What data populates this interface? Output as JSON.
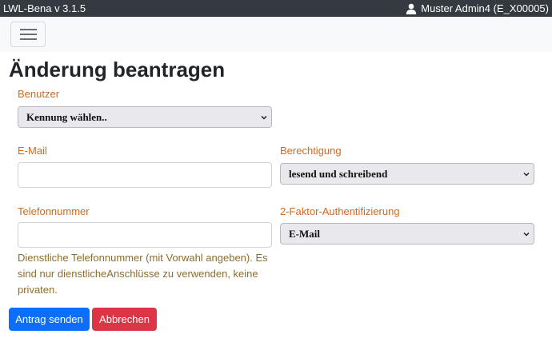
{
  "header": {
    "app_title": "LWL-Bena v 3.1.5",
    "user_label": "Muster Admin4 (E_X00005)",
    "user_icon": "user-icon"
  },
  "navbar": {
    "menu_icon": "hamburger-menu-icon"
  },
  "page": {
    "title": "Änderung beantragen"
  },
  "form": {
    "benutzer": {
      "label": "Benutzer",
      "selected": "Kennung wählen.."
    },
    "email": {
      "label": "E-Mail",
      "value": ""
    },
    "berechtigung": {
      "label": "Berechtigung",
      "selected": "lesend und schreibend"
    },
    "telefon": {
      "label": "Telefonnummer",
      "value": "",
      "help": "Dienstliche Telefonnummer (mit Vorwahl angeben). Es sind nur dienstlicheAnschlüsse zu verwenden, keine privaten."
    },
    "zwei_faktor": {
      "label": "2-Faktor-Authentifizierung",
      "selected": "E-Mail"
    }
  },
  "actions": {
    "submit_label": "Antrag senden",
    "cancel_label": "Abbrechen"
  },
  "colors": {
    "topbar": "#343a40",
    "label": "#d2691e",
    "help": "#8b6d2c",
    "primary": "#0d6efd",
    "danger": "#dc3545"
  }
}
